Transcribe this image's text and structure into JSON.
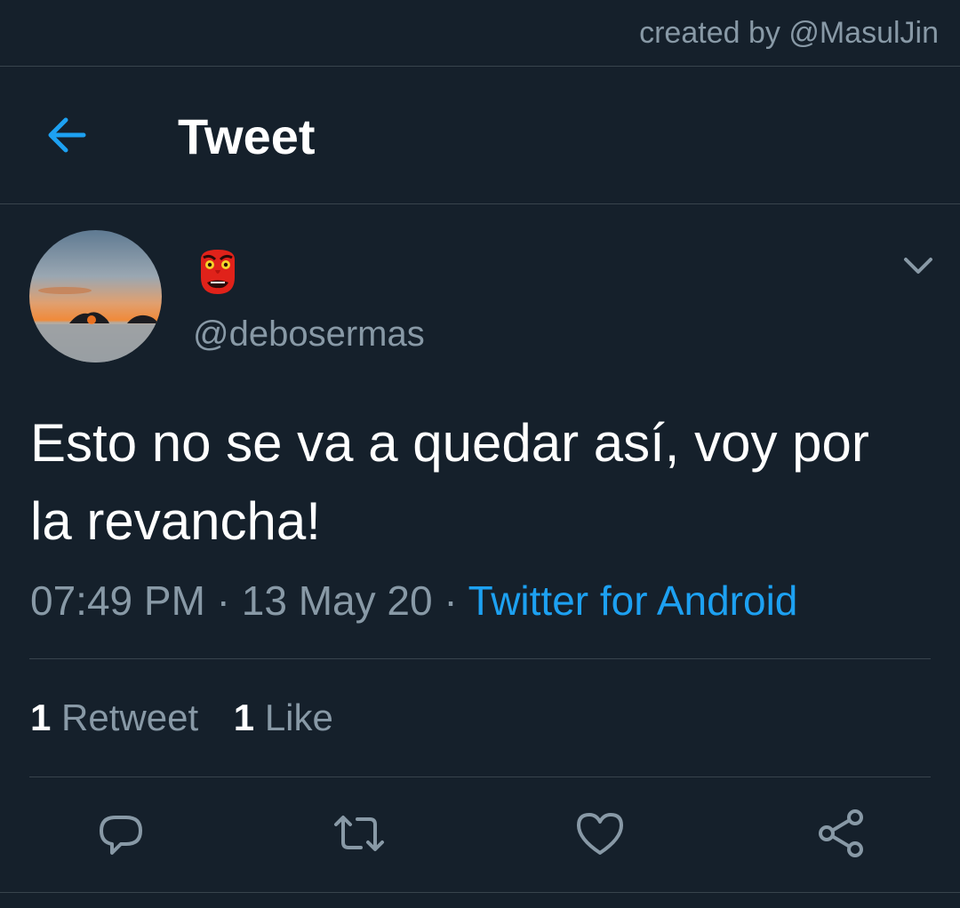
{
  "credit": "created by @MasulJin",
  "header": {
    "back_icon": "arrow-left-icon",
    "title": "Tweet"
  },
  "tweet": {
    "avatar": "sunset-avatar",
    "display_name_icon": "tengu-mask-emoji",
    "handle": "@debosermas",
    "text": "Esto no se va a quedar así, voy por la revancha!",
    "time": "07:49 PM",
    "separator": " · ",
    "date": "13 May 20",
    "source": "Twitter for Android"
  },
  "stats": {
    "retweet_count": "1",
    "retweet_label": "Retweet",
    "like_count": "1",
    "like_label": "Like"
  },
  "actions": {
    "reply_icon": "reply-icon",
    "retweet_icon": "retweet-icon",
    "like_icon": "heart-icon",
    "share_icon": "share-icon"
  },
  "colors": {
    "background": "#15202b",
    "accent": "#1da1f2",
    "secondary_text": "#8899a6",
    "divider": "#38444d"
  }
}
